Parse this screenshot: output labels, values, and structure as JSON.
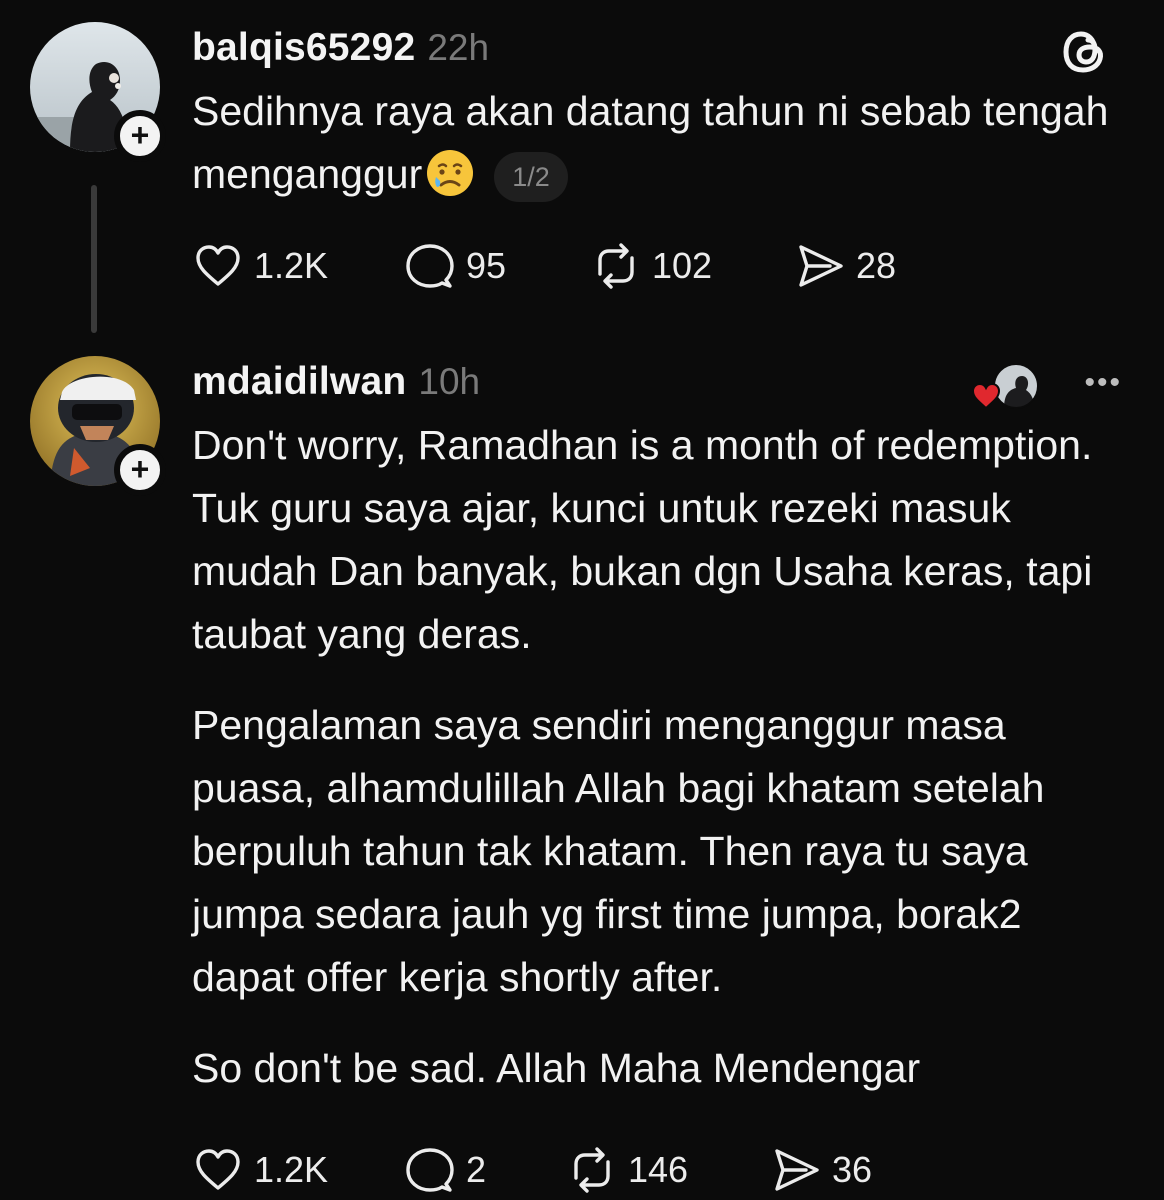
{
  "post1": {
    "username": "balqis65292",
    "time": "22h",
    "text": "Sedihnya raya akan datang tahun ni sebab tengah menganggur",
    "page_indicator": "1/2",
    "actions": {
      "likes": "1.2K",
      "replies": "95",
      "reposts": "102",
      "shares": "28"
    }
  },
  "post2": {
    "username": "mdaidilwan",
    "time": "10h",
    "paragraphs": [
      "Don't worry, Ramadhan is a month of redemption. Tuk guru saya ajar, kunci untuk rezeki masuk mudah Dan banyak, bukan dgn Usaha keras, tapi taubat yang deras.",
      "Pengalaman saya sendiri menganggur masa puasa, alhamdulillah Allah bagi khatam setelah berpuluh tahun tak khatam. Then raya tu saya jumpa sedara jauh yg first time jumpa, borak2 dapat offer kerja shortly after.",
      "So don't be sad. Allah Maha Mendengar"
    ],
    "actions": {
      "likes": "1.2K",
      "replies": "2",
      "reposts": "146",
      "shares": "36"
    }
  },
  "icons": {
    "like": "heart-icon",
    "reply": "speech-bubble-icon",
    "repost": "repost-arrows-icon",
    "share": "send-icon",
    "brand": "threads-logo-icon",
    "more": "more-dots-icon",
    "follow": "plus-icon",
    "emoji": "crying-face-emoji"
  },
  "colors": {
    "background": "#0b0b0b",
    "text": "#f2f2f2",
    "muted": "#7a7a7a",
    "liked_heart": "#e0282e"
  }
}
